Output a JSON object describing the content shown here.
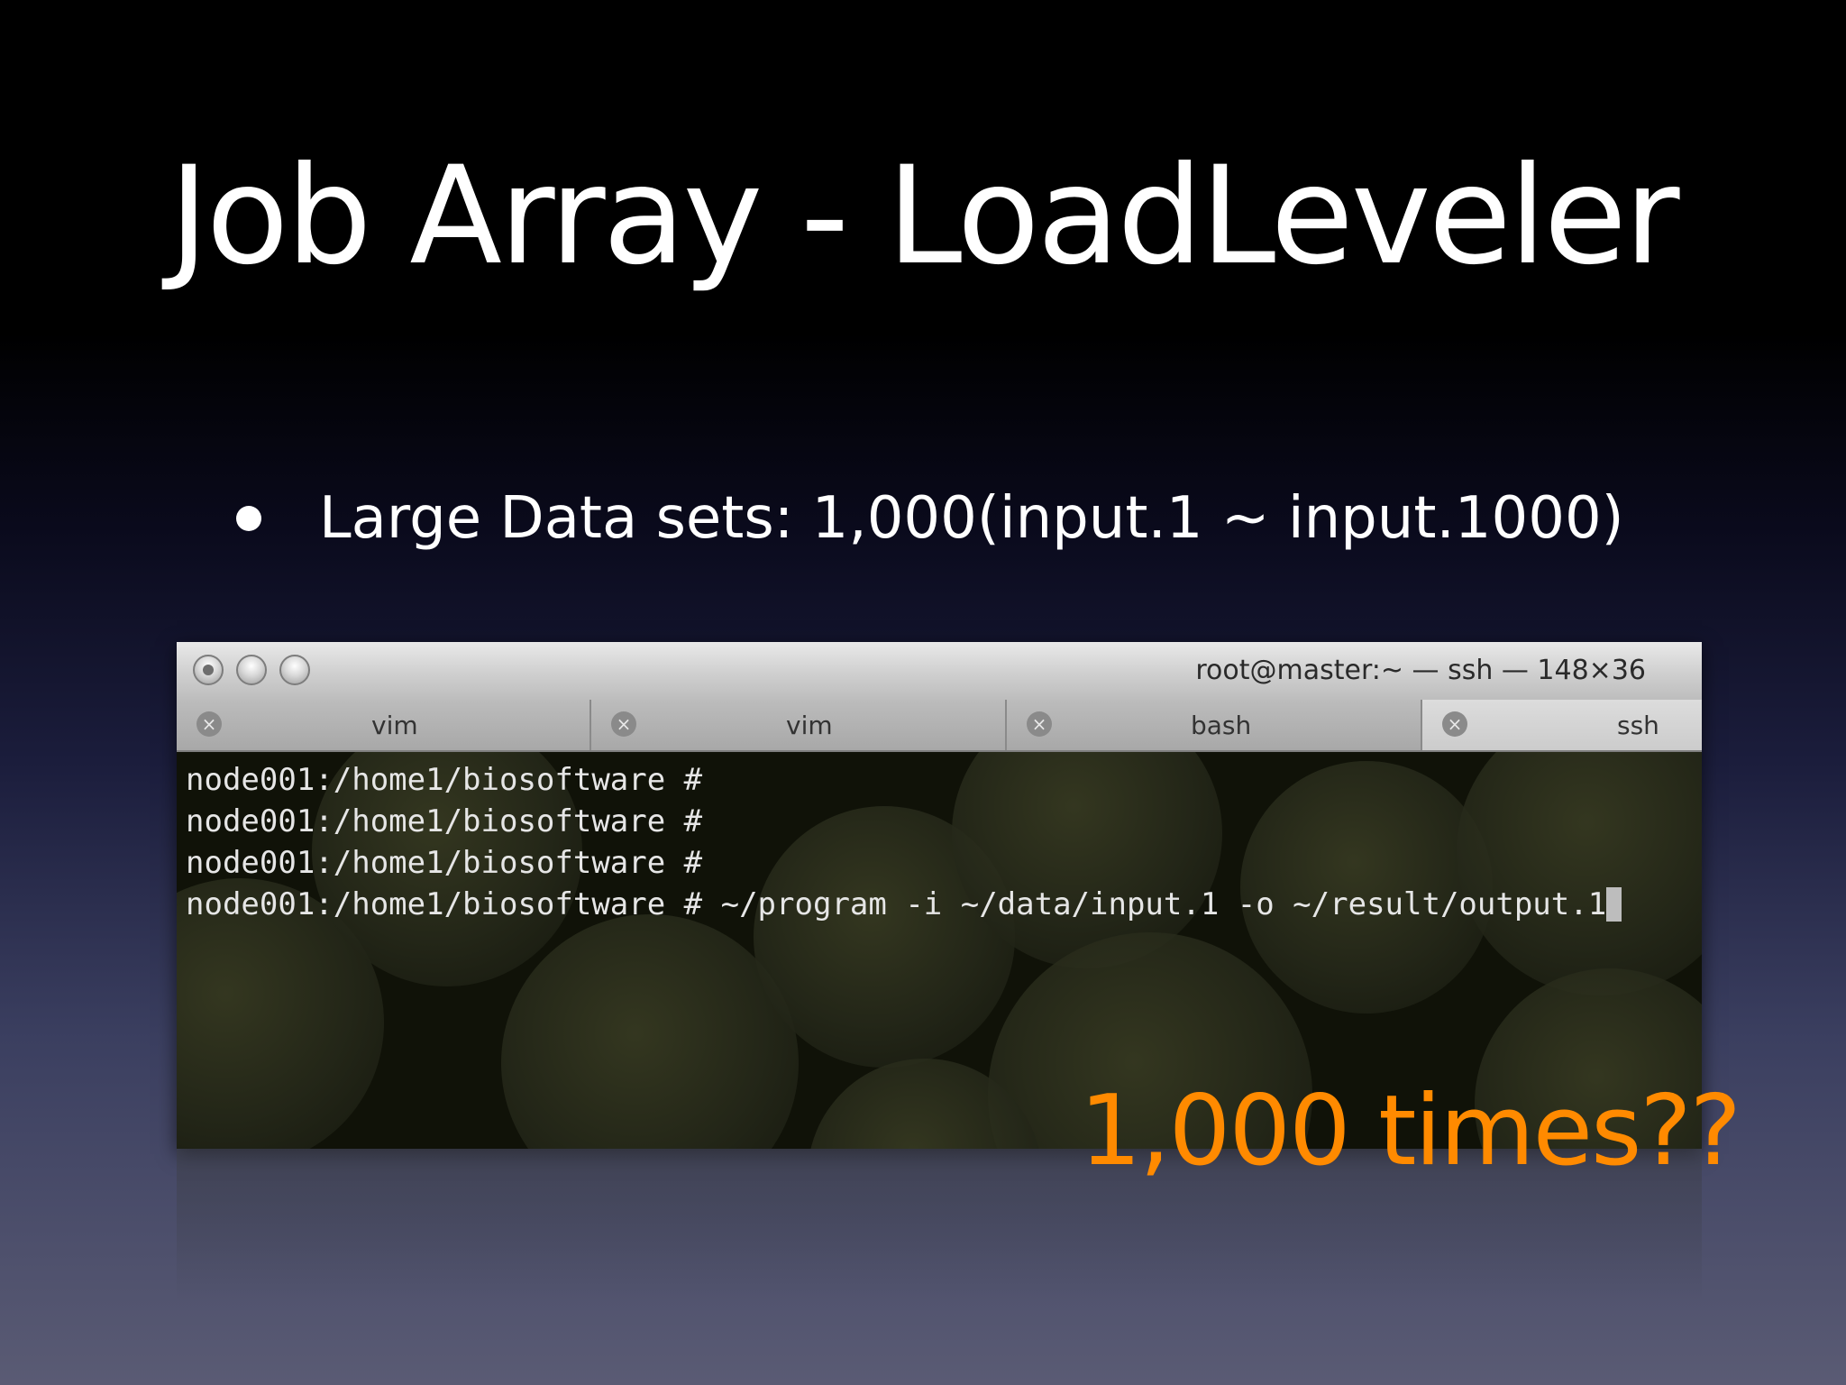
{
  "slide": {
    "title": "Job Array - LoadLeveler",
    "bullet": "Large Data sets: 1,000(input.1 ~ input.1000)",
    "callout": "1,000 times??",
    "callout_color": "#ff8a00"
  },
  "terminal": {
    "window_title": "root@master:~ — ssh — 148×36",
    "traffic_lights": [
      "close-icon",
      "minimize-icon",
      "zoom-icon"
    ],
    "tabs": [
      {
        "label": "vim",
        "close_icon": "close-icon"
      },
      {
        "label": "vim",
        "close_icon": "close-icon"
      },
      {
        "label": "bash",
        "close_icon": "close-icon"
      },
      {
        "label": "ssh",
        "close_icon": "close-icon",
        "active": true
      }
    ],
    "lines": [
      "node001:/home1/biosoftware #",
      "node001:/home1/biosoftware #",
      "node001:/home1/biosoftware #",
      "node001:/home1/biosoftware # ~/program -i ~/data/input.1 -o ~/result/output.1"
    ]
  }
}
